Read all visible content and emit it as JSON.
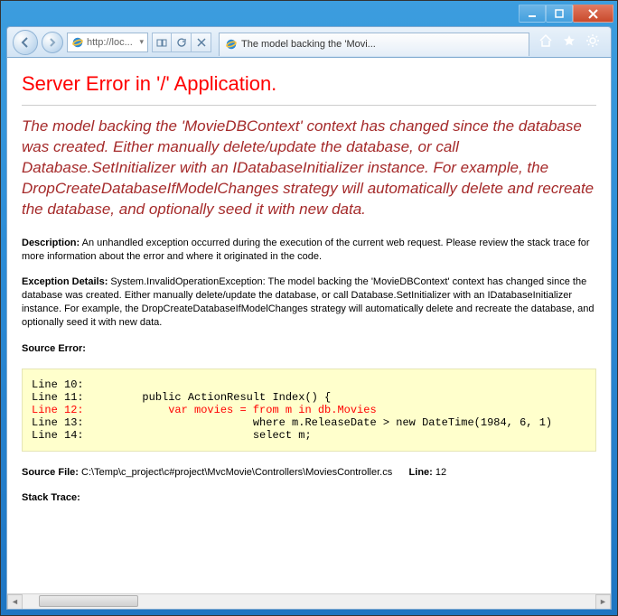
{
  "window": {
    "url_display": "http://loc...",
    "tab_title": "The model backing the 'Movi..."
  },
  "page": {
    "title": "Server Error in '/' Application.",
    "message": "The model backing the 'MovieDBContext' context has changed since the database was created. Either manually delete/update the database, or call Database.SetInitializer with an IDatabaseInitializer instance. For example, the DropCreateDatabaseIfModelChanges strategy will automatically delete and recreate the database, and optionally seed it with new data.",
    "description_label": "Description:",
    "description": "An unhandled exception occurred during the execution of the current web request. Please review the stack trace for more information about the error and where it originated in the code.",
    "exception_label": "Exception Details:",
    "exception": "System.InvalidOperationException: The model backing the 'MovieDBContext' context has changed since the database was created. Either manually delete/update the database, or call Database.SetInitializer with an IDatabaseInitializer instance. For example, the DropCreateDatabaseIfModelChanges strategy will automatically delete and recreate the database, and optionally seed it with new data.",
    "source_error_label": "Source Error:",
    "source_lines": {
      "l10": "Line 10:",
      "l11": "Line 11:         public ActionResult Index() {",
      "l12": "Line 12:             var movies = from m in db.Movies",
      "l13": "Line 13:                          where m.ReleaseDate > new DateTime(1984, 6, 1)",
      "l14": "Line 14:                          select m;"
    },
    "source_file_label": "Source File:",
    "source_file": "C:\\Temp\\c_project\\c#project\\MvcMovie\\Controllers\\MoviesController.cs",
    "line_label": "Line:",
    "line_number": "12",
    "stack_trace_label": "Stack Trace:"
  }
}
